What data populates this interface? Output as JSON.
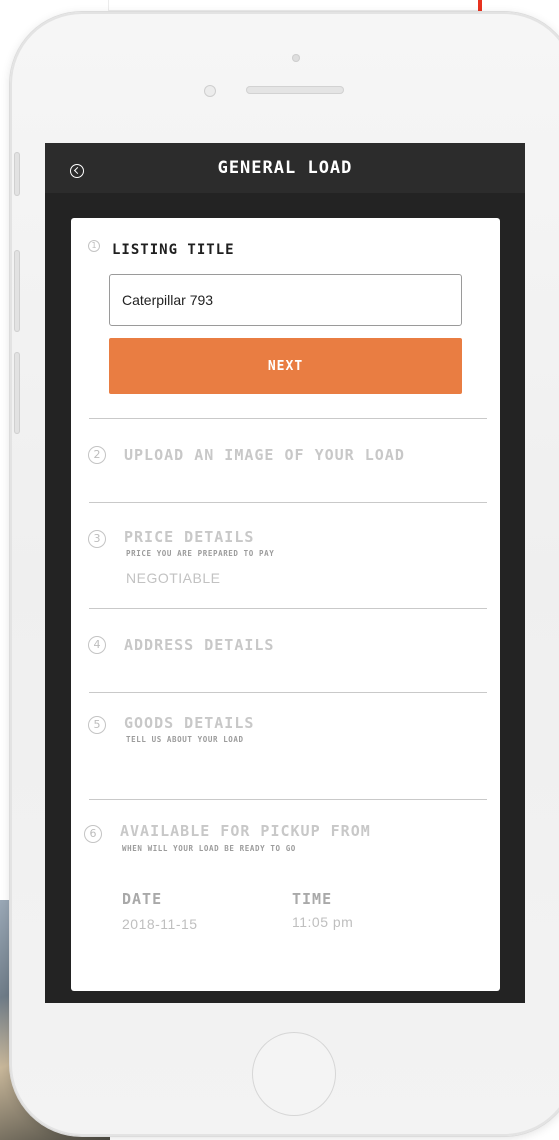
{
  "colors": {
    "accent": "#e97d42",
    "screen_bg": "#232323",
    "header_bg": "#2c2c2c",
    "card_bg": "#ffffff",
    "muted_text": "#c8c8c8"
  },
  "header": {
    "back_icon": "back-circle-icon",
    "title": "GENERAL LOAD"
  },
  "steps": {
    "listing": {
      "number": "1",
      "title": "LISTING TITLE",
      "input_value": "Caterpillar 793",
      "next_label": "NEXT"
    },
    "upload": {
      "number": "2",
      "title": "UPLOAD AN IMAGE OF YOUR LOAD"
    },
    "price": {
      "number": "3",
      "title": "PRICE DETAILS",
      "subtitle": "PRICE YOU ARE PREPARED TO PAY",
      "value": "NEGOTIABLE"
    },
    "address": {
      "number": "4",
      "title": "ADDRESS DETAILS"
    },
    "goods": {
      "number": "5",
      "title": "GOODS DETAILS",
      "subtitle": "TELL US ABOUT YOUR LOAD"
    },
    "pickup": {
      "number": "6",
      "title": "AVAILABLE FOR PICKUP FROM",
      "subtitle": "WHEN WILL YOUR LOAD BE READY TO GO",
      "date_label": "DATE",
      "date_value": "2018-11-15",
      "time_label": "TIME",
      "time_value": "11:05 pm"
    }
  }
}
